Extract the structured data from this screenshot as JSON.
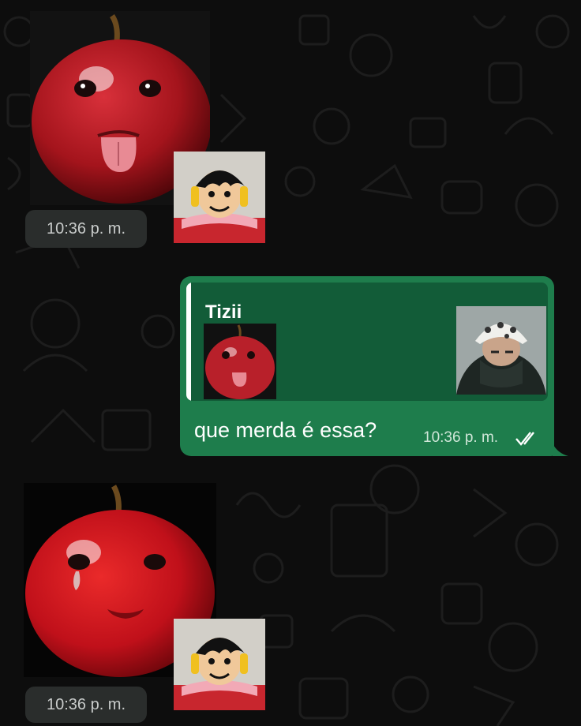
{
  "chat": {
    "messages": [
      {
        "type": "sticker",
        "direction": "incoming",
        "sticker": "apple-tongue",
        "time": "10:36 p. m."
      },
      {
        "type": "text",
        "direction": "outgoing",
        "reply": {
          "author": "Tizii",
          "sticker": "apple-tongue"
        },
        "text": "que merda é essa?",
        "time": "10:36 p. m.",
        "status": "read-double-check-icon"
      },
      {
        "type": "sticker",
        "direction": "incoming",
        "sticker": "apple-crying",
        "time": "10:36 p. m."
      }
    ],
    "avatars": [
      "luffy-avatar",
      "law-avatar"
    ]
  },
  "colors": {
    "background": "#0d0d0d",
    "outgoing_bubble": "#1e7d4c",
    "quote_background": "#125c38",
    "time_pill": "#2a2d2c"
  }
}
